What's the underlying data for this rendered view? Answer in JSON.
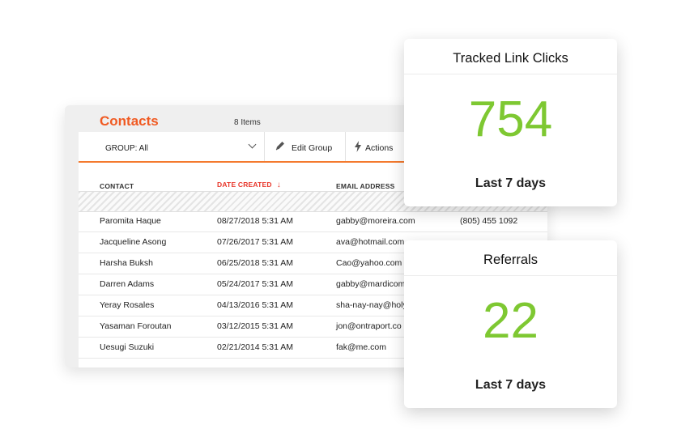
{
  "contacts": {
    "title": "Contacts",
    "items_count": "8 Items",
    "group_label": "GROUP:  All",
    "edit_group_label": "Edit Group",
    "actions_label": "Actions",
    "columns": {
      "contact": "CONTACT",
      "date_created": "DATE CREATED",
      "email": "EMAIL ADDRESS"
    },
    "rows": [
      {
        "name": "Paromita Haque",
        "date": "08/27/2018 5:31 AM",
        "email": "gabby@moreira.com",
        "phone": "(805) 455 1092"
      },
      {
        "name": "Jacqueline Asong",
        "date": "07/26/2017 5:31 AM",
        "email": "ava@hotmail.com",
        "phone": ""
      },
      {
        "name": "Harsha Buksh",
        "date": "06/25/2018 5:31 AM",
        "email": "Cao@yahoo.com",
        "phone": ""
      },
      {
        "name": "Darren Adams",
        "date": "05/24/2017 5:31 AM",
        "email": "gabby@mardicom",
        "phone": ""
      },
      {
        "name": "Yeray Rosales",
        "date": "04/13/2016 5:31 AM",
        "email": "sha-nay-nay@holy",
        "phone": ""
      },
      {
        "name": "Yasaman Foroutan",
        "date": "03/12/2015 5:31 AM",
        "email": "jon@ontraport.co",
        "phone": ""
      },
      {
        "name": "Uesugi Suzuki",
        "date": "02/21/2014 5:31 AM",
        "email": "fak@me.com",
        "phone": ""
      }
    ]
  },
  "cards": [
    {
      "title": "Tracked Link Clicks",
      "value": "754",
      "period": "Last 7 days"
    },
    {
      "title": "Referrals",
      "value": "22",
      "period": "Last 7 days"
    }
  ],
  "icons": {
    "sort": "arrow-down-icon",
    "edit": "pencil-icon",
    "actions": "lightning-icon",
    "dropdown": "chevron-down-icon"
  },
  "colors": {
    "accent_orange": "#f05a22",
    "sort_red": "#e8372b",
    "stat_green": "#7ec832"
  }
}
